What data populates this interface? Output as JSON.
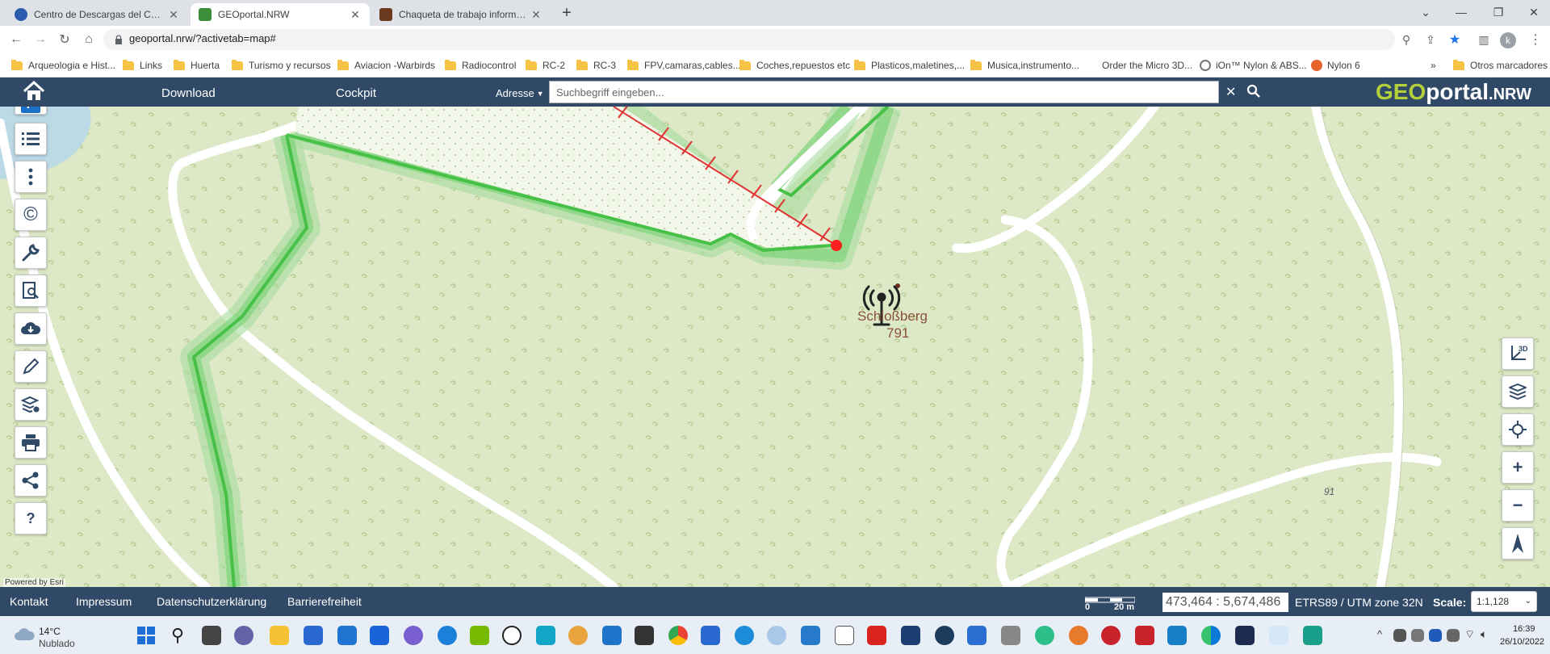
{
  "browser": {
    "tabs": [
      {
        "label": "Centro de Descargas del CNIG (I",
        "color": "#2a5cad",
        "active": false
      },
      {
        "label": "GEOportal.NRW",
        "color": "#3b8f3b",
        "active": true
      },
      {
        "label": "Chaqueta de trabajo informal cá",
        "color": "#6b3a1e",
        "active": false
      }
    ],
    "new_tab": "+",
    "url": "geoportal.nrw/?activetab=map#",
    "profile_initial": "k",
    "bookmarks": [
      "Arqueologia e Hist...",
      "Links",
      "Huerta",
      "Turismo y recursos",
      "Aviacion -Warbirds",
      "Radiocontrol",
      "RC-2",
      "RC-3",
      "FPV,camaras,cables....",
      "Coches,repuestos etc",
      "Plasticos,maletines,...",
      "Musica,instrumento...",
      "Order the Micro 3D...",
      "iOn™ Nylon & ABS...",
      "Nylon 6"
    ],
    "bookmarks_more": "»",
    "other_bookmarks": "Otros marcadores"
  },
  "header": {
    "download": "Download",
    "cockpit": "Cockpit",
    "adresse": "Adresse",
    "search_placeholder": "Suchbegriff eingeben...",
    "logo_geo": "GEO",
    "logo_portal": "portal",
    "logo_nrw": ".NRW"
  },
  "map": {
    "place_name": "Schloßberg",
    "elevation": "791",
    "road_label": "91",
    "attribution": "Powered by Esri",
    "right_buttons": [
      "3D",
      "layers",
      "locate",
      "+",
      "−",
      "north"
    ],
    "help_label": "?"
  },
  "footer": {
    "links": [
      "Kontakt",
      "Impressum",
      "Datenschutzerklärung",
      "Barrierefreiheit"
    ],
    "scalebar_0": "0",
    "scalebar_20": "20 m",
    "coords": "473,464 : 5,674,486",
    "crs": "ETRS89 / UTM zone 32N",
    "scale_label": "Scale:",
    "scale_value": "1:1,128"
  },
  "taskbar": {
    "temperature": "14°C",
    "weather": "Nublado",
    "time": "16:39",
    "date": "26/10/2022"
  }
}
